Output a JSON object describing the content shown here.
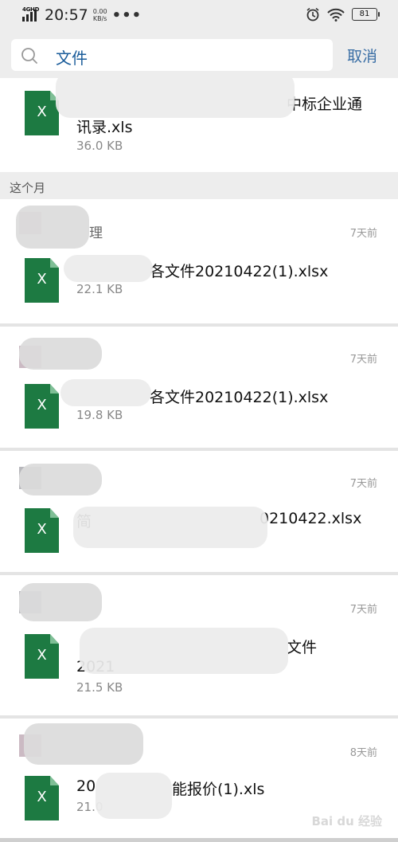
{
  "status_bar": {
    "network": "4GHD",
    "time": "20:57",
    "speed_value": "0.00",
    "speed_unit": "KB/s",
    "more": "•••",
    "battery": "81"
  },
  "search": {
    "query": "文件",
    "cancel_label": "取消"
  },
  "top_item": {
    "name_line1": "中标企业通",
    "name_line2": "讯录.xls",
    "size": "36.0 KB"
  },
  "section": {
    "title": "这个月"
  },
  "items": [
    {
      "sender": "理",
      "time": "7天前",
      "name": "各文件20210422(1).xlsx",
      "size": "22.1 KB"
    },
    {
      "sender": "",
      "time": "7天前",
      "name": "各文件20210422(1).xlsx",
      "size": "19.8 KB"
    },
    {
      "sender": "",
      "time": "7天前",
      "name_prefix": "简",
      "name": "0210422.xlsx",
      "size": ""
    },
    {
      "sender": "",
      "time": "7天前",
      "name_prefix": "",
      "name": "文件",
      "name_line2": "2021",
      "size": "21.5 KB"
    },
    {
      "sender": "",
      "time": "8天前",
      "name_prefix": "20",
      "name": "能报价(1).xls",
      "size": "21.0"
    }
  ],
  "icon_glyph": "X",
  "watermark": "Bai du 经验"
}
